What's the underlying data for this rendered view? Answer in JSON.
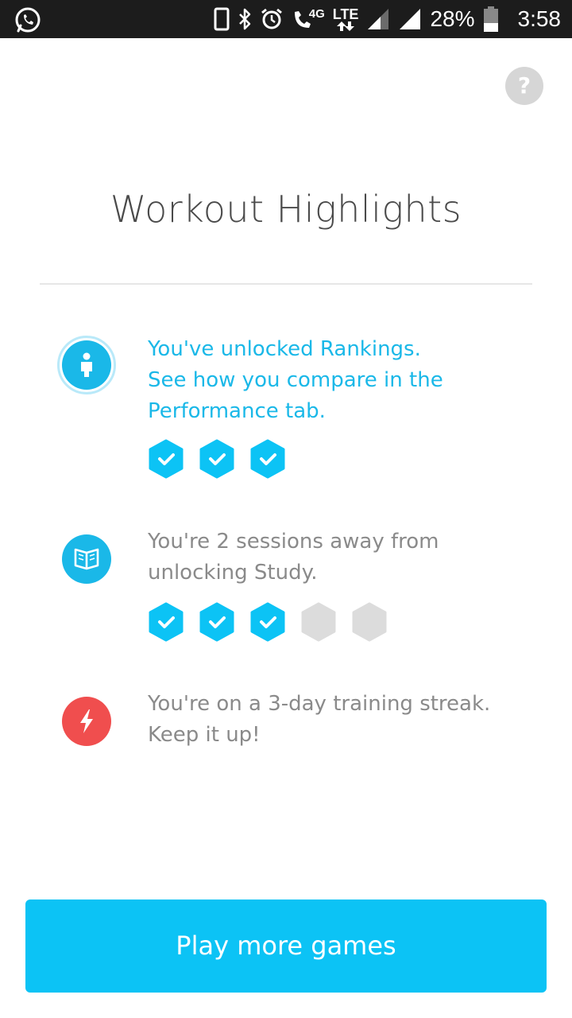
{
  "status_bar": {
    "network_type": "4G",
    "lte_label": "LTE",
    "battery_percent": "28%",
    "time": "3:58",
    "icons": [
      "whatsapp-icon",
      "phone-device-icon",
      "bluetooth-icon",
      "alarm-icon",
      "wifi-calling-icon",
      "signal-icon",
      "signal-icon",
      "battery-icon"
    ]
  },
  "help": {
    "label": "?"
  },
  "title": "Workout Highlights",
  "highlights": [
    {
      "icon": "person-icon",
      "color": "#1ab8e8",
      "text_lines": [
        "You've unlocked Rankings.",
        "See how you compare in the",
        "Performance tab."
      ],
      "badges": {
        "completed": 3,
        "total": 3
      }
    },
    {
      "icon": "book-icon",
      "color": "#1ab8e8",
      "text_lines": [
        "You're 2 sessions away from",
        "unlocking Study."
      ],
      "badges": {
        "completed": 3,
        "total": 5
      }
    },
    {
      "icon": "lightning-icon",
      "color": "#f04e4e",
      "text_lines": [
        "You're on a 3-day training streak.",
        "Keep it up!"
      ]
    }
  ],
  "cta": {
    "label": "Play more games"
  },
  "colors": {
    "accent": "#0cc3f5",
    "badge_done": "#0cc3f5",
    "badge_pending": "#dcdcdc",
    "streak": "#f04e4e"
  }
}
